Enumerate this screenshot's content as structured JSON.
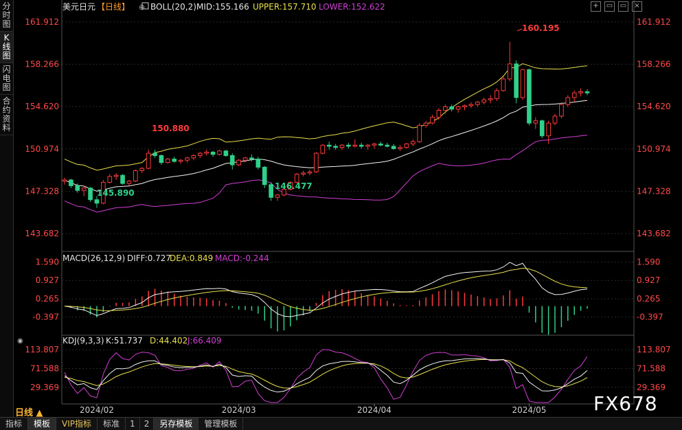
{
  "sidebar": {
    "tabs": [
      {
        "label": "分时图",
        "chars": [
          "分",
          "时",
          "图"
        ]
      },
      {
        "label": "K线图",
        "chars": [
          "K",
          "线",
          "图"
        ]
      },
      {
        "label": "闪电图",
        "chars": [
          "闪",
          "电",
          "图"
        ]
      },
      {
        "label": "合约资料",
        "chars": [
          "合",
          "约",
          "资",
          "料"
        ]
      }
    ]
  },
  "header": {
    "instrument": "美元日元",
    "period_tag": "【日线】",
    "boll_label": "BOLL(20,2)",
    "mid": "MID:155.166",
    "upper": "UPPER:157.710",
    "lower": "LOWER:152.622"
  },
  "window_buttons": [
    "+",
    "▭",
    "▭",
    "×"
  ],
  "main_axis_labels": [
    "161.912",
    "158.266",
    "154.620",
    "150.974",
    "147.328",
    "143.682"
  ],
  "annotations": {
    "high_label": "160.195",
    "early_high_label": "150.880",
    "early_low_label": "145.890",
    "mar_low_label": "146.477"
  },
  "macd_header": {
    "label": "MACD(26,12,9)",
    "diff": "DIFF:0.727",
    "dea": "DEA:0.849",
    "macd": "MACD:-0.244"
  },
  "macd_axis_labels": [
    "1.590",
    "0.927",
    "0.265",
    "-0.397"
  ],
  "kdj_header": {
    "label": "KDJ(9,3,3)",
    "k": "K:51.737",
    "d": "D:44.402",
    "j": "J:66.409"
  },
  "kdj_axis_labels": [
    "113.807",
    "71.588",
    "29.369"
  ],
  "date_labels": [
    "2024/02",
    "2024/03",
    "2024/04",
    "2024/05"
  ],
  "period_button": "日线 ▲",
  "bottom_tabs": [
    "指标",
    "模板",
    "VIP指标",
    "标准",
    "1",
    "2",
    "另存模板",
    "管理模板"
  ],
  "watermark": "FX678",
  "colors": {
    "up": "#ff3b3b",
    "down": "#2fd08a",
    "mid": "#f4f4f4",
    "upper": "#e8e04a",
    "lower": "#d23fd6",
    "axis_text": "#ff4a4a",
    "diff": "#f4f4f4",
    "dea": "#e8e04a",
    "macd": "#d23fd6"
  },
  "chart_data": {
    "type": "candlestick",
    "dates": [
      "2024/02",
      "2024/03",
      "2024/04",
      "2024/05"
    ],
    "candles": [
      [
        148.2,
        148.5,
        147.9,
        148.3
      ],
      [
        148.3,
        148.4,
        147.6,
        147.8
      ],
      [
        147.8,
        148.0,
        147.2,
        147.4
      ],
      [
        147.4,
        147.8,
        146.9,
        147.6
      ],
      [
        147.6,
        147.7,
        146.4,
        146.6
      ],
      [
        146.6,
        146.9,
        145.9,
        146.3
      ],
      [
        146.3,
        148.3,
        146.2,
        148.1
      ],
      [
        148.1,
        148.8,
        148.0,
        148.6
      ],
      [
        148.6,
        148.9,
        148.3,
        148.7
      ],
      [
        148.7,
        148.8,
        147.9,
        148.0
      ],
      [
        148.0,
        148.3,
        147.8,
        148.2
      ],
      [
        148.2,
        149.2,
        148.1,
        149.1
      ],
      [
        149.1,
        149.4,
        148.9,
        149.3
      ],
      [
        149.3,
        150.9,
        149.2,
        150.6
      ],
      [
        150.6,
        150.9,
        150.2,
        150.4
      ],
      [
        150.4,
        150.5,
        149.6,
        149.8
      ],
      [
        149.8,
        150.2,
        149.7,
        150.1
      ],
      [
        150.1,
        150.3,
        149.8,
        149.9
      ],
      [
        149.9,
        150.1,
        149.7,
        150.0
      ],
      [
        150.0,
        150.3,
        149.8,
        150.2
      ],
      [
        150.2,
        150.5,
        150.0,
        150.4
      ],
      [
        150.4,
        150.7,
        150.2,
        150.6
      ],
      [
        150.6,
        150.9,
        150.4,
        150.7
      ],
      [
        150.7,
        150.8,
        150.3,
        150.5
      ],
      [
        150.5,
        150.9,
        150.4,
        150.8
      ],
      [
        150.8,
        150.9,
        150.3,
        150.4
      ],
      [
        150.4,
        150.6,
        149.2,
        149.6
      ],
      [
        149.6,
        150.1,
        149.5,
        150.0
      ],
      [
        150.0,
        150.3,
        149.8,
        150.2
      ],
      [
        150.2,
        150.5,
        149.9,
        150.1
      ],
      [
        150.1,
        150.3,
        149.2,
        149.4
      ],
      [
        149.4,
        149.5,
        147.6,
        147.9
      ],
      [
        147.9,
        148.1,
        146.5,
        146.8
      ],
      [
        146.8,
        147.1,
        146.5,
        147.0
      ],
      [
        147.0,
        147.6,
        146.9,
        147.5
      ],
      [
        147.5,
        148.2,
        147.4,
        148.1
      ],
      [
        148.1,
        148.9,
        148.0,
        148.8
      ],
      [
        148.8,
        149.1,
        148.6,
        148.9
      ],
      [
        148.9,
        149.2,
        148.7,
        149.0
      ],
      [
        149.0,
        150.7,
        148.9,
        150.6
      ],
      [
        150.6,
        151.4,
        150.5,
        151.3
      ],
      [
        151.3,
        151.6,
        150.9,
        151.2
      ],
      [
        151.2,
        151.4,
        150.9,
        151.1
      ],
      [
        151.1,
        151.4,
        150.9,
        151.3
      ],
      [
        151.3,
        151.5,
        151.0,
        151.2
      ],
      [
        151.2,
        151.8,
        151.1,
        151.3
      ],
      [
        151.3,
        151.5,
        151.0,
        151.2
      ],
      [
        151.2,
        151.4,
        150.9,
        151.3
      ],
      [
        151.3,
        151.5,
        151.0,
        151.4
      ],
      [
        151.4,
        151.6,
        151.2,
        151.3
      ],
      [
        151.3,
        151.5,
        151.1,
        151.2
      ],
      [
        151.2,
        151.4,
        150.9,
        151.0
      ],
      [
        151.0,
        151.3,
        150.8,
        151.1
      ],
      [
        151.1,
        151.5,
        151.0,
        151.4
      ],
      [
        151.4,
        151.8,
        151.2,
        151.6
      ],
      [
        151.6,
        153.2,
        151.5,
        153.0
      ],
      [
        153.0,
        153.4,
        152.8,
        153.2
      ],
      [
        153.2,
        153.9,
        153.1,
        153.7
      ],
      [
        153.7,
        154.5,
        153.5,
        154.3
      ],
      [
        154.3,
        154.8,
        154.0,
        154.6
      ],
      [
        154.6,
        154.8,
        154.2,
        154.4
      ],
      [
        154.4,
        154.7,
        154.1,
        154.6
      ],
      [
        154.6,
        154.8,
        154.3,
        154.7
      ],
      [
        154.7,
        155.0,
        154.5,
        154.8
      ],
      [
        154.8,
        155.1,
        154.6,
        155.0
      ],
      [
        155.0,
        155.4,
        154.8,
        155.2
      ],
      [
        155.2,
        155.6,
        154.9,
        155.3
      ],
      [
        155.3,
        156.2,
        155.1,
        156.0
      ],
      [
        156.0,
        157.2,
        155.9,
        157.0
      ],
      [
        157.0,
        160.2,
        156.8,
        158.3
      ],
      [
        158.3,
        158.6,
        154.9,
        155.4
      ],
      [
        155.4,
        157.8,
        155.2,
        157.8
      ],
      [
        157.8,
        157.9,
        153.0,
        153.2
      ],
      [
        153.2,
        153.7,
        152.7,
        153.4
      ],
      [
        153.4,
        153.5,
        151.9,
        152.1
      ],
      [
        152.1,
        153.4,
        151.4,
        153.2
      ],
      [
        153.2,
        154.0,
        153.0,
        153.8
      ],
      [
        153.8,
        155.0,
        153.6,
        154.8
      ],
      [
        154.8,
        155.6,
        154.6,
        155.4
      ],
      [
        155.4,
        156.0,
        155.0,
        155.8
      ],
      [
        155.8,
        156.2,
        155.5,
        155.9
      ],
      [
        155.9,
        156.1,
        155.6,
        155.8
      ]
    ],
    "boll": {
      "mid": 155.166,
      "upper": 157.71,
      "lower": 152.622
    },
    "main_ylim": [
      142.5,
      162.5
    ],
    "macd": {
      "diff": 0.727,
      "dea": 0.849,
      "macd": -0.244,
      "ylim": [
        -1.0,
        1.75
      ]
    },
    "kdj": {
      "k": 51.737,
      "d": 44.402,
      "j": 66.409,
      "ylim": [
        -5,
        125
      ]
    }
  }
}
